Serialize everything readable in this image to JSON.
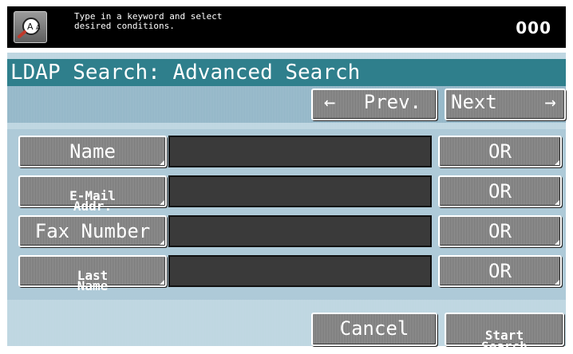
{
  "header": {
    "message": "Type in a keyword and select\ndesired conditions.",
    "counter": "000",
    "icon": "magnifier-aa-icon"
  },
  "title": "LDAP Search: Advanced Search",
  "nav": {
    "prev_label": "Prev.",
    "next_label": "Next",
    "prev_arrow": "←",
    "next_arrow": "→"
  },
  "rows": [
    {
      "label": "Name",
      "value": "",
      "condition": "OR"
    },
    {
      "label": "E-Mail\nAddr.",
      "value": "",
      "condition": "OR"
    },
    {
      "label": "Fax Number",
      "value": "",
      "condition": "OR"
    },
    {
      "label": "Last\nName",
      "value": "",
      "condition": "OR"
    }
  ],
  "footer": {
    "cancel_label": "Cancel",
    "start_label": "Start\nSearch"
  }
}
